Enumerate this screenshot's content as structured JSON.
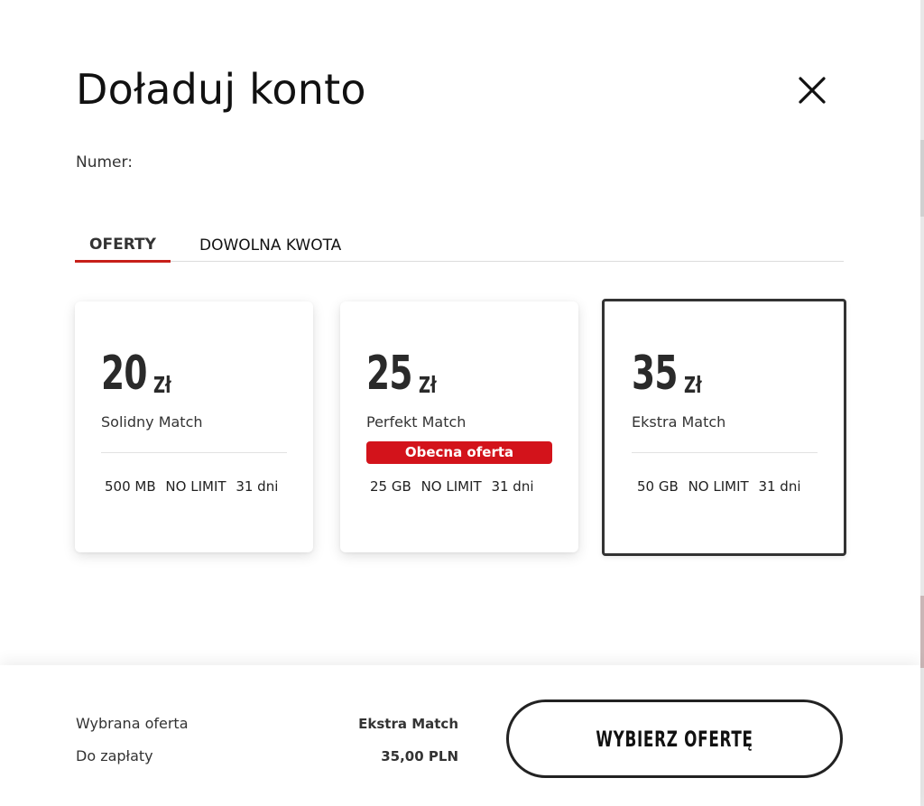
{
  "dialog": {
    "title": "Doładuj konto",
    "number_label": "Numer:"
  },
  "tabs": [
    {
      "label": "OFERTY",
      "active": true
    },
    {
      "label": "DOWOLNA KWOTA",
      "active": false
    }
  ],
  "offers": [
    {
      "amount": "20",
      "currency": "Zł",
      "name": "Solidny Match",
      "badge": "",
      "features": [
        "500 MB",
        "NO LIMIT",
        "31 dni"
      ],
      "selected": false
    },
    {
      "amount": "25",
      "currency": "Zł",
      "name": "Perfekt Match",
      "badge": "Obecna oferta",
      "features": [
        "25 GB",
        "NO LIMIT",
        "31 dni"
      ],
      "selected": false
    },
    {
      "amount": "35",
      "currency": "Zł",
      "name": "Ekstra Match",
      "badge": "",
      "features": [
        "50 GB",
        "NO LIMIT",
        "31 dni"
      ],
      "selected": true
    }
  ],
  "footer": {
    "selected_label": "Wybrana oferta",
    "selected_value": "Ekstra Match",
    "payment_label": "Do zapłaty",
    "payment_value": "35,00 PLN",
    "button_label": "WYBIERZ OFERTĘ"
  },
  "colors": {
    "accent": "#c7201a",
    "badge": "#d3131b"
  }
}
